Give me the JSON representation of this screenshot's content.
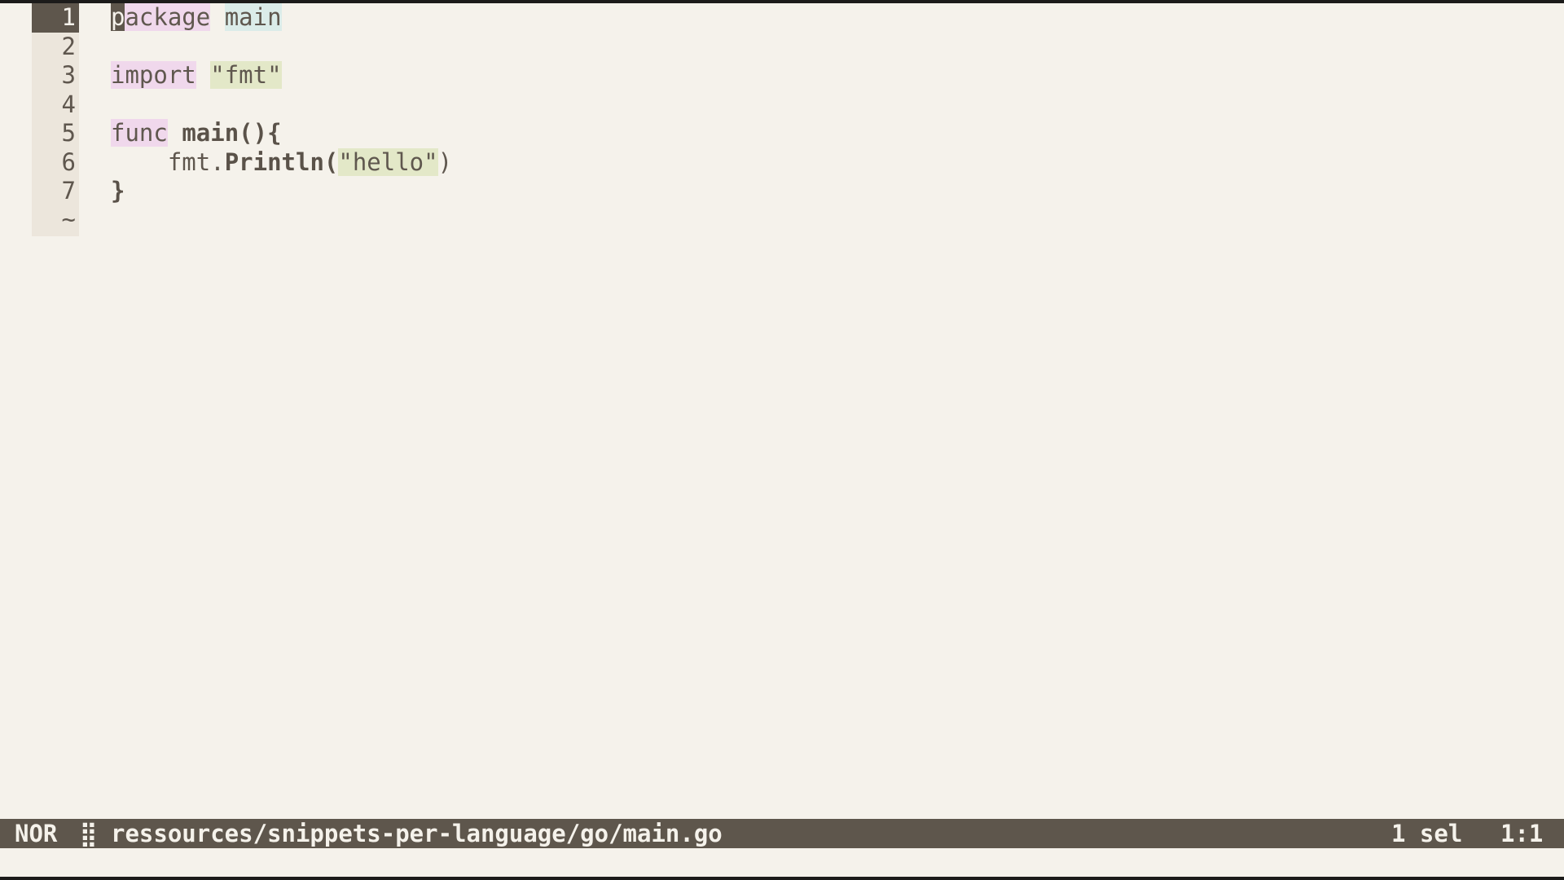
{
  "editor": {
    "gutter": {
      "line_numbers": [
        "1",
        "2",
        "3",
        "4",
        "5",
        "6",
        "7"
      ],
      "empty_marker": "~"
    },
    "lines": {
      "l1": {
        "kw": "package",
        "cursor_char": "p",
        "kw_rest": "ackage",
        "space": " ",
        "ident": "main"
      },
      "l3": {
        "kw": "import",
        "space": " ",
        "str": "\"fmt\""
      },
      "l5": {
        "kw": "func",
        "space": " ",
        "fn": "main",
        "rest": "(){"
      },
      "l6": {
        "indent": "    ",
        "obj": "fmt.",
        "method": "Println",
        "open": "(",
        "str": "\"hello\"",
        "close": ")"
      },
      "l7": {
        "brace": "}"
      }
    }
  },
  "statusbar": {
    "mode": "NOR",
    "modified_icon": "⣿",
    "file_path": "ressources/snippets-per-language/go/main.go",
    "selections": "1 sel",
    "cursor_position": "1:1"
  },
  "colors": {
    "background": "#f5f2eb",
    "gutter": "#ece6dc",
    "statusbar": "#5e564c",
    "keyword_bg": "#f0d8ec",
    "string_bg": "#e3e8c8",
    "identifier_bg": "#dbece9"
  }
}
